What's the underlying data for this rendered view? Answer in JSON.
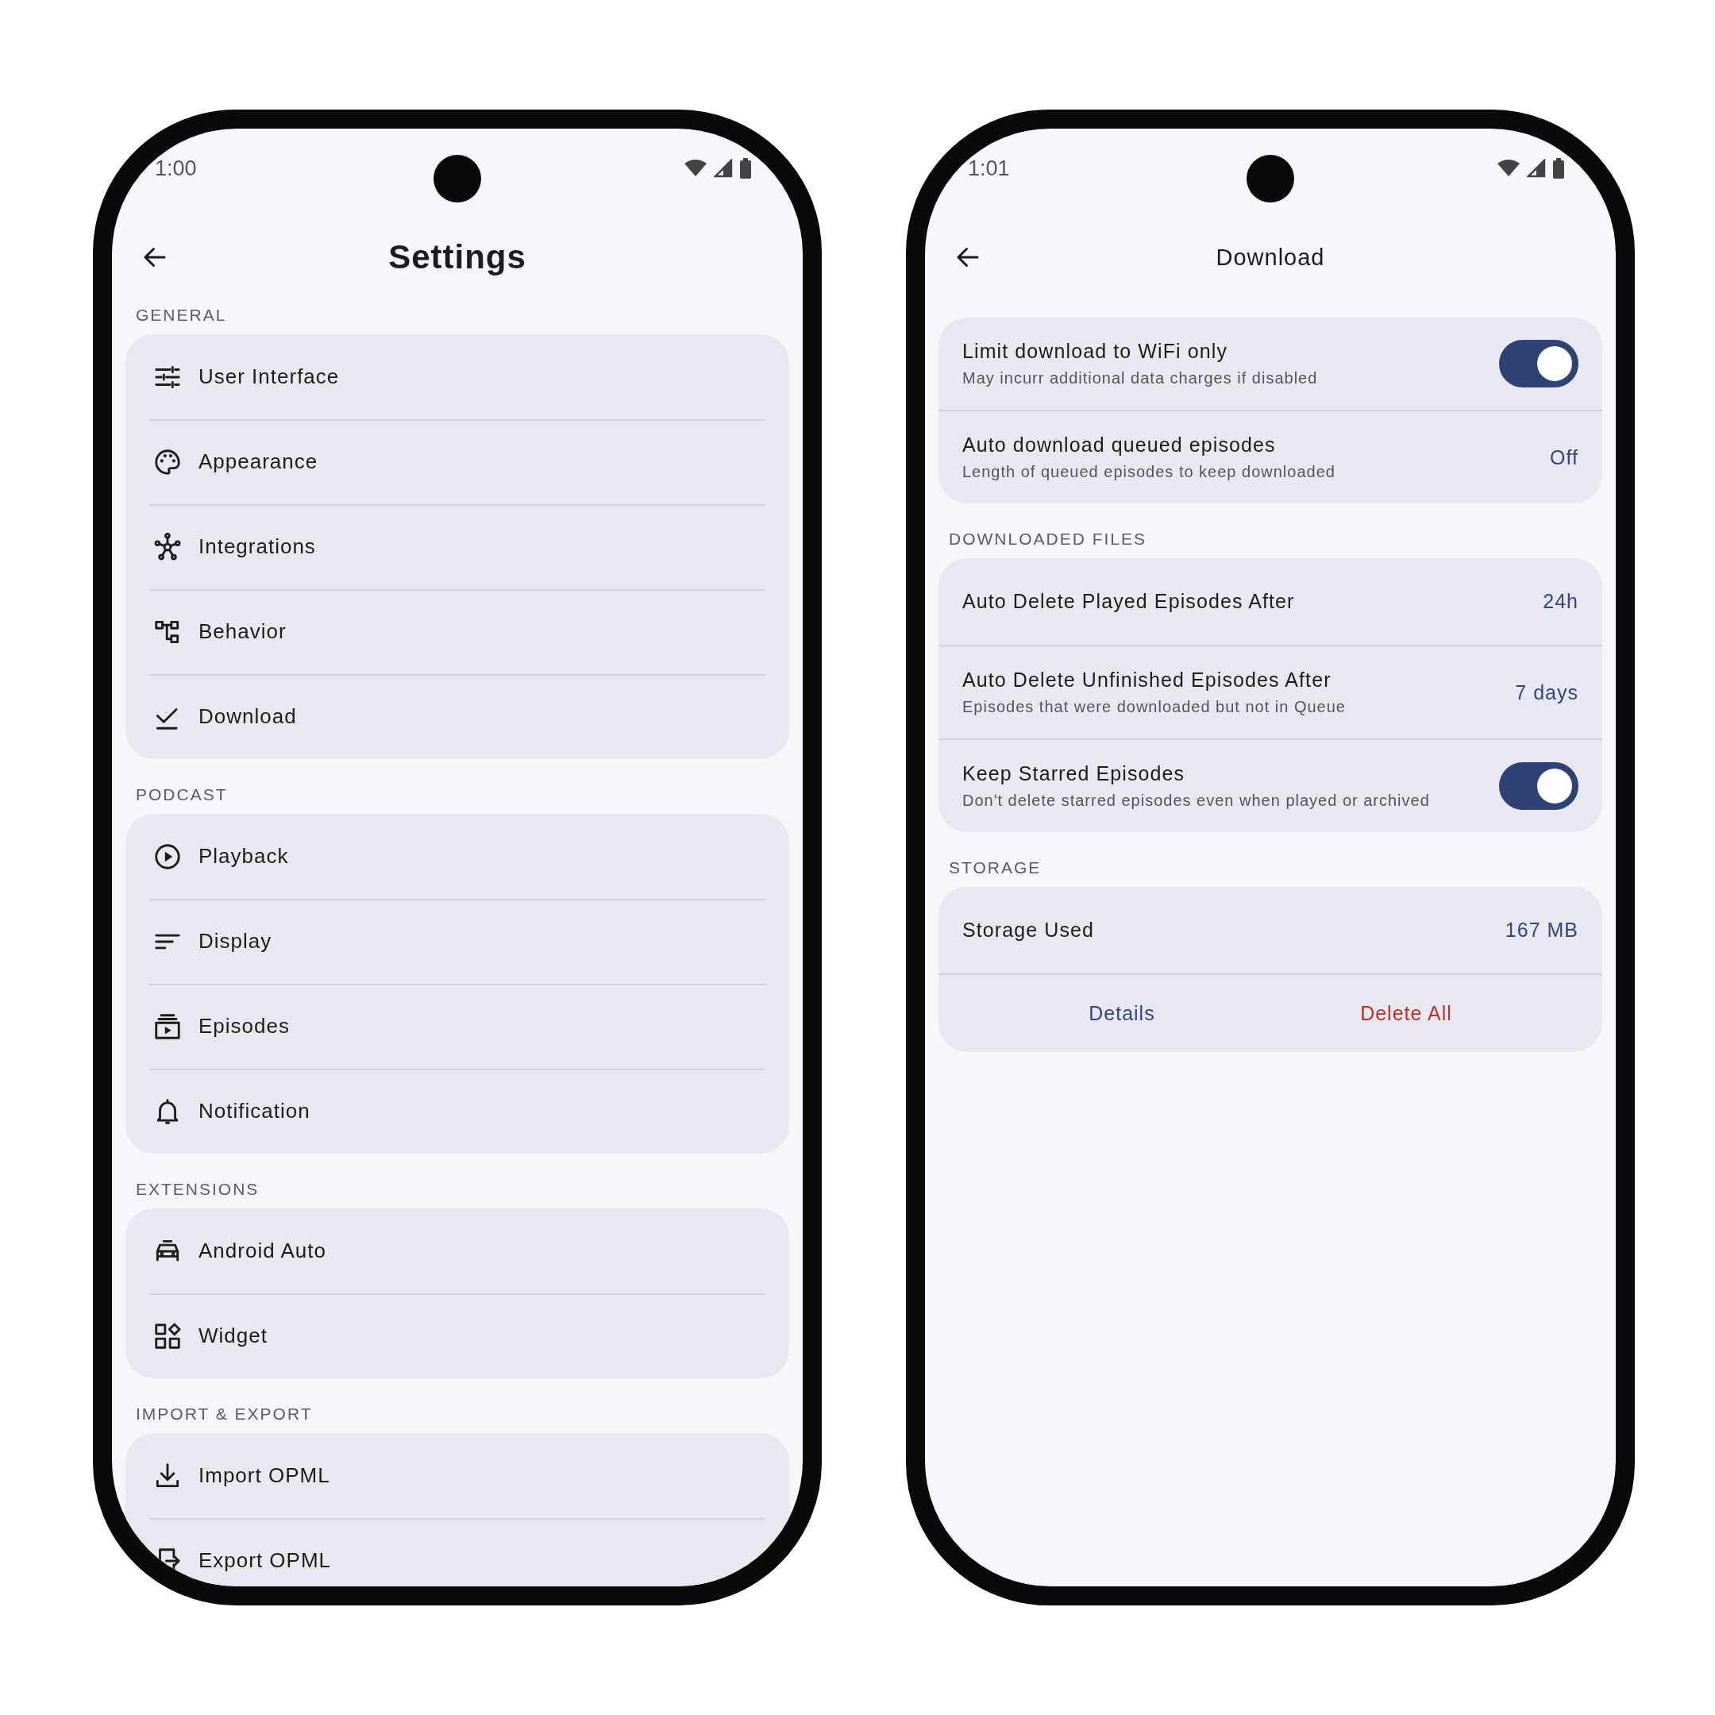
{
  "phones": [
    {
      "kind": "menu",
      "status": {
        "time": "1:00"
      },
      "title": "Settings",
      "sections": [
        {
          "header": "GENERAL",
          "items": [
            {
              "label": "User Interface"
            },
            {
              "label": "Appearance"
            },
            {
              "label": "Integrations"
            },
            {
              "label": "Behavior"
            },
            {
              "label": "Download"
            }
          ]
        },
        {
          "header": "PODCAST",
          "items": [
            {
              "label": "Playback"
            },
            {
              "label": "Display"
            },
            {
              "label": "Episodes"
            },
            {
              "label": "Notification"
            }
          ]
        },
        {
          "header": "EXTENSIONS",
          "items": [
            {
              "label": "Android Auto"
            },
            {
              "label": "Widget"
            }
          ]
        },
        {
          "header": "IMPORT & EXPORT",
          "items": [
            {
              "label": "Import OPML"
            },
            {
              "label": "Export OPML"
            }
          ]
        }
      ]
    },
    {
      "kind": "detail",
      "status": {
        "time": "1:01"
      },
      "title": "Download",
      "sections": [
        {
          "items": [
            {
              "kind": "toggle",
              "title": "Limit download to WiFi only",
              "subtitle": "May incurr additional data charges if disabled",
              "on": true
            },
            {
              "kind": "value",
              "title": "Auto download queued episodes",
              "subtitle": "Length of queued episodes to keep downloaded",
              "value": "Off"
            }
          ]
        },
        {
          "header": "DOWNLOADED FILES",
          "items": [
            {
              "kind": "value",
              "title": "Auto Delete Played Episodes After",
              "value": "24h"
            },
            {
              "kind": "value",
              "title": "Auto Delete Unfinished Episodes After",
              "subtitle": "Episodes that were downloaded but not in Queue",
              "value": "7 days"
            },
            {
              "kind": "toggle",
              "title": "Keep Starred Episodes",
              "subtitle": "Don't delete starred episodes even when played or archived",
              "on": true
            }
          ]
        },
        {
          "header": "STORAGE",
          "items": [
            {
              "kind": "value",
              "title": "Storage Used",
              "value": "167 MB"
            },
            {
              "kind": "actions",
              "actions": [
                {
                  "label": "Details",
                  "kind": "neutral"
                },
                {
                  "label": "Delete All",
                  "kind": "danger"
                }
              ]
            }
          ]
        }
      ]
    }
  ]
}
